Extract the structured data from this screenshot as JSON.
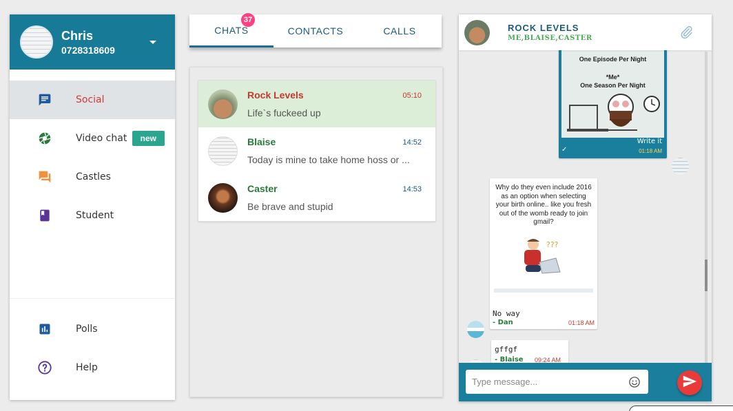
{
  "user": {
    "name": "Chris",
    "phone": "0728318609"
  },
  "nav": {
    "items": [
      {
        "label": "Social",
        "icon": "chat-icon",
        "color": "#1e5a9c",
        "active": true
      },
      {
        "label": "Video chat",
        "icon": "aperture-icon",
        "color": "#2a7a3a",
        "badge": "new"
      },
      {
        "label": "Castles",
        "icon": "forum-icon",
        "color": "#f0913c"
      },
      {
        "label": "Student",
        "icon": "book-icon",
        "color": "#5b3596"
      }
    ],
    "bottom_items": [
      {
        "label": "Polls",
        "icon": "poll-icon",
        "color": "#1e5a9c"
      },
      {
        "label": "Help",
        "icon": "help-icon",
        "color": "#5b3596"
      }
    ]
  },
  "tabs": [
    {
      "label": "CHATS",
      "count": "37",
      "active": true
    },
    {
      "label": "CONTACTS"
    },
    {
      "label": "CALLS"
    }
  ],
  "chats": [
    {
      "name": "Rock Levels",
      "time": "05:10",
      "preview": "Life`s fuckeed up",
      "active": true
    },
    {
      "name": "Blaise",
      "time": "14:52",
      "preview": "Today is mine to take home hoss or ..."
    },
    {
      "name": "Caster",
      "time": "14:53",
      "preview": "Be brave and stupid"
    }
  ],
  "conversation": {
    "title": "ROCK LEVELS",
    "members": "ME,BLAISE,CASTER",
    "outgoing": {
      "image_text": {
        "line1": "One Episode Per Night",
        "line2": "*Me*",
        "line3": "One Season Per Night"
      },
      "text": "Write it",
      "time": "01:18 AM",
      "status": "✓"
    },
    "incoming": [
      {
        "caption": "Why do they even include 2016 as an option when selecting your birth online.. like you fresh out of the womb ready to join gmail?",
        "text": "No way",
        "author": "- Dan",
        "time": "01:18 AM"
      },
      {
        "text": "gffgf",
        "author": "- Blaise",
        "time": "09:24 AM"
      }
    ],
    "composer_placeholder": "Type message..."
  },
  "colors": {
    "primary": "#177a96",
    "active_chat": "#dcedd8",
    "badge": "#ff4081",
    "new_badge": "#2ba58e",
    "send": "#ea3b3b"
  }
}
